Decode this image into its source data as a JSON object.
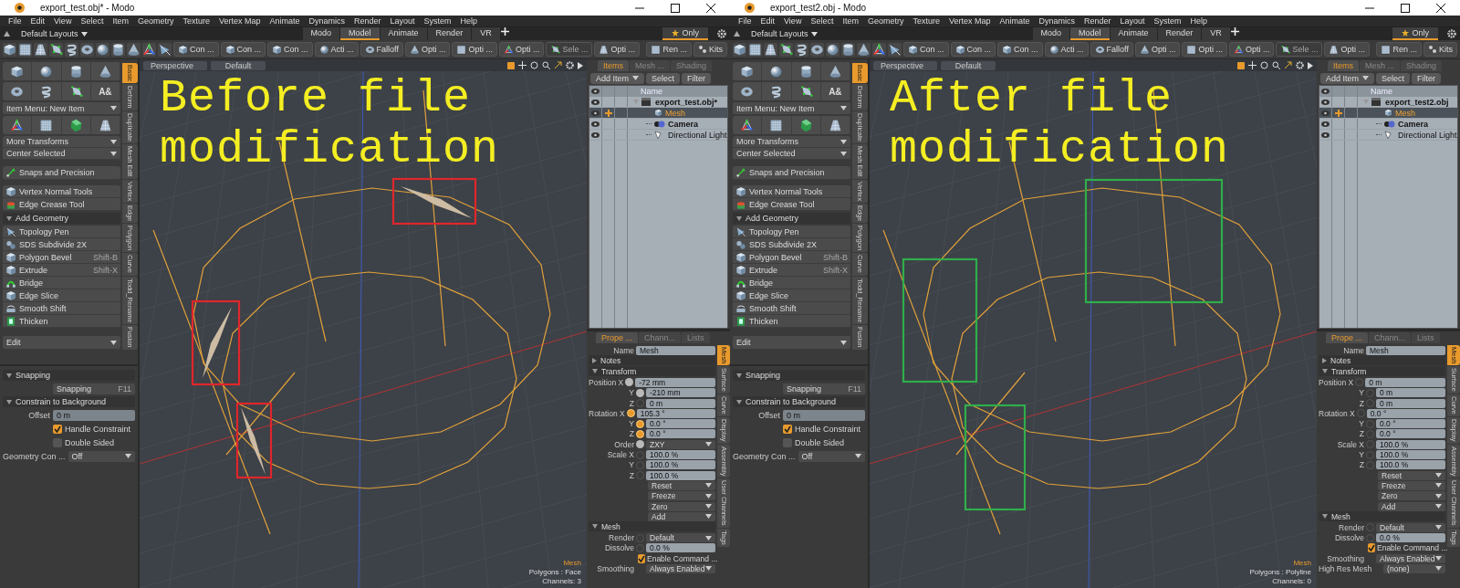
{
  "windows": [
    {
      "title_bar": {
        "title": "export_test.obj* - Modo"
      },
      "menu": [
        "File",
        "Edit",
        "View",
        "Select",
        "Item",
        "Geometry",
        "Texture",
        "Vertex Map",
        "Animate",
        "Dynamics",
        "Render",
        "Layout",
        "System",
        "Help"
      ],
      "layout_bar": {
        "layouts": "Default Layouts",
        "tabs": [
          {
            "label": "Modo",
            "selected": false
          },
          {
            "label": "Model",
            "selected": true
          },
          {
            "label": "Animate",
            "selected": false
          },
          {
            "label": "Render",
            "selected": false
          },
          {
            "label": "VR",
            "selected": false
          }
        ],
        "only": "Only"
      },
      "toolbar": [
        {
          "label": "Con ...",
          "disabled": false
        },
        {
          "label": "Con ...",
          "disabled": false
        },
        {
          "label": "Con ...",
          "disabled": false
        },
        {
          "label": "Acti ...",
          "disabled": false
        },
        {
          "label": "Falloff",
          "disabled": false
        },
        {
          "label": "Opti ...",
          "disabled": false
        },
        {
          "label": "Opti ...",
          "disabled": false
        },
        {
          "label": "Opti ...",
          "disabled": false
        },
        {
          "label": "Sele ...",
          "disabled": true
        },
        {
          "label": "Opti ...",
          "disabled": false
        },
        {
          "label": "Ren ...",
          "disabled": false
        },
        {
          "label": "Kits",
          "disabled": false
        }
      ],
      "toolbox": {
        "text_tool_glyph": "A&",
        "item_menu": "Item Menu: New Item",
        "dropdowns": [
          "More Transforms",
          "Center Selected"
        ],
        "snaps": "Snaps and Precision",
        "tools": [
          "Vertex Normal Tools",
          "Edge Crease Tool"
        ],
        "add_geometry": {
          "title": "Add Geometry",
          "expanded": true,
          "items": [
            {
              "label": "Topology Pen"
            },
            {
              "label": "SDS Subdivide 2X"
            },
            {
              "label": "Polygon Bevel",
              "shortcut": "Shift-B"
            },
            {
              "label": "Extrude",
              "shortcut": "Shift-X"
            },
            {
              "label": "Bridge"
            },
            {
              "label": "Edge Slice"
            },
            {
              "label": "Smooth Shift"
            },
            {
              "label": "Thicken"
            }
          ]
        },
        "edit": "Edit",
        "vertical_tabs": [
          {
            "label": "Basic",
            "selected": true
          },
          {
            "label": "Deform",
            "selected": false
          },
          {
            "label": "Duplicate",
            "selected": false
          },
          {
            "label": "Mesh Edit",
            "selected": false
          },
          {
            "label": "Vertex",
            "selected": false
          },
          {
            "label": "Edge",
            "selected": false
          },
          {
            "label": "Polygon",
            "selected": false
          },
          {
            "label": "Curve",
            "selected": false
          },
          {
            "label": "Todd_Rename",
            "selected": false
          },
          {
            "label": "Fusion",
            "selected": false
          }
        ]
      },
      "snapping": {
        "title": "Snapping",
        "button": "Snapping",
        "shortcut": "F11",
        "constrain": "Constrain to Background",
        "offset_label": "Offset",
        "offset": "0 m",
        "handle_constraint": {
          "label": "Handle Constraint",
          "checked": true
        },
        "double_sided": {
          "label": "Double Sided",
          "checked": false
        },
        "geometry_label": "Geometry Con ...",
        "geometry_value": "Off"
      },
      "viewport": {
        "view": "Perspective",
        "style": "Default",
        "caption": [
          "Before file",
          "modification"
        ],
        "boxes": [
          {
            "color": "#e0262b",
            "kind": "artifact"
          },
          {
            "color": "#e0262b",
            "kind": "artifact"
          },
          {
            "color": "#e0262b",
            "kind": "artifact"
          }
        ],
        "info": [
          "Mesh",
          "Polygons : Face",
          "Channels: 3"
        ]
      },
      "items_panel": {
        "tabs": [
          {
            "label": "Items",
            "selected": true
          },
          {
            "label": "Mesh ...",
            "selected": false
          },
          {
            "label": "Shading",
            "selected": false
          }
        ],
        "buttons": [
          "Add Item",
          "Select",
          "Filter"
        ],
        "column": "Name",
        "tree": [
          {
            "name": "export_test.obj*",
            "kind": "scene",
            "selected": false,
            "expanded": true,
            "children": [
              {
                "name": "Mesh",
                "kind": "mesh",
                "selected": true
              },
              {
                "name": "Camera",
                "kind": "camera",
                "selected": false
              },
              {
                "name": "Directional Light",
                "kind": "light",
                "selected": false
              }
            ]
          }
        ]
      },
      "properties": {
        "tabs": [
          {
            "label": "Prope ...",
            "selected": true
          },
          {
            "label": "Chann...",
            "selected": false
          },
          {
            "label": "Lists",
            "selected": false
          }
        ],
        "side_tabs": [
          {
            "label": "Mesh",
            "selected": true
          },
          {
            "label": "Surface",
            "selected": false
          },
          {
            "label": "Curve",
            "selected": false
          },
          {
            "label": "Display",
            "selected": false
          },
          {
            "label": "Assembly",
            "selected": false
          },
          {
            "label": "User Channels",
            "selected": false
          },
          {
            "label": "Tags",
            "selected": false
          }
        ],
        "rows": [
          {
            "kind": "name",
            "label": "Name",
            "value": "Mesh"
          },
          {
            "kind": "section",
            "label": "Notes",
            "expanded": false
          },
          {
            "kind": "section",
            "label": "Transform",
            "expanded": true
          },
          {
            "kind": "field",
            "label": "Position X",
            "value": "-72 mm",
            "edited": true,
            "keyed": false
          },
          {
            "kind": "field",
            "label": "Y",
            "value": "-210 mm",
            "edited": true,
            "keyed": false
          },
          {
            "kind": "field",
            "label": "Z",
            "value": "0 m",
            "edited": false,
            "keyed": false
          },
          {
            "kind": "field",
            "label": "Rotation X",
            "value": "105.3 °",
            "edited": false,
            "keyed": true
          },
          {
            "kind": "field",
            "label": "Y",
            "value": "0.0 °",
            "edited": false,
            "keyed": true
          },
          {
            "kind": "field",
            "label": "Z",
            "value": "0.0 °",
            "edited": false,
            "keyed": true
          },
          {
            "kind": "dropdown",
            "label": "Order",
            "value": "ZXY",
            "edited": true,
            "keyed": false
          },
          {
            "kind": "field",
            "label": "Scale X",
            "value": "100.0 %",
            "edited": false,
            "keyed": false
          },
          {
            "kind": "field",
            "label": "Y",
            "value": "100.0 %",
            "edited": false,
            "keyed": false
          },
          {
            "kind": "field",
            "label": "Z",
            "value": "100.0 %",
            "edited": false,
            "keyed": false
          },
          {
            "kind": "menu",
            "value": "Reset"
          },
          {
            "kind": "menu",
            "value": "Freeze"
          },
          {
            "kind": "menu",
            "value": "Zero"
          },
          {
            "kind": "menu",
            "value": "Add"
          },
          {
            "kind": "section",
            "label": "Mesh",
            "expanded": true
          },
          {
            "kind": "dropdown",
            "label": "Render",
            "value": "Default",
            "edited": false,
            "keyed": false
          },
          {
            "kind": "field",
            "label": "Dissolve",
            "value": "0.0 %",
            "edited": false,
            "keyed": false
          },
          {
            "kind": "checkbox",
            "label": "Enable Command ...",
            "checked": true
          },
          {
            "kind": "dropdown",
            "label": "Smoothing",
            "value": "Always Enabled"
          }
        ]
      }
    },
    {
      "title_bar": {
        "title": "export_test2.obj - Modo"
      },
      "menu": [
        "File",
        "Edit",
        "View",
        "Select",
        "Item",
        "Geometry",
        "Texture",
        "Vertex Map",
        "Animate",
        "Dynamics",
        "Render",
        "Layout",
        "System",
        "Help"
      ],
      "layout_bar": {
        "layouts": "Default Layouts",
        "tabs": [
          {
            "label": "Modo",
            "selected": false
          },
          {
            "label": "Model",
            "selected": true
          },
          {
            "label": "Animate",
            "selected": false
          },
          {
            "label": "Render",
            "selected": false
          },
          {
            "label": "VR",
            "selected": false
          }
        ],
        "only": "Only"
      },
      "toolbar": [
        {
          "label": "Con ...",
          "disabled": false
        },
        {
          "label": "Con ...",
          "disabled": false
        },
        {
          "label": "Con ...",
          "disabled": false
        },
        {
          "label": "Acti ...",
          "disabled": false
        },
        {
          "label": "Falloff",
          "disabled": false
        },
        {
          "label": "Opti ...",
          "disabled": false
        },
        {
          "label": "Opti ...",
          "disabled": false
        },
        {
          "label": "Opti ...",
          "disabled": false
        },
        {
          "label": "Sele ...",
          "disabled": true
        },
        {
          "label": "Opti ...",
          "disabled": false
        },
        {
          "label": "Ren ...",
          "disabled": false
        },
        {
          "label": "Kits",
          "disabled": false
        }
      ],
      "toolbox": {
        "text_tool_glyph": "A&",
        "item_menu": "Item Menu: New Item",
        "dropdowns": [
          "More Transforms",
          "Center Selected"
        ],
        "snaps": "Snaps and Precision",
        "tools": [
          "Vertex Normal Tools",
          "Edge Crease Tool"
        ],
        "add_geometry": {
          "title": "Add Geometry",
          "expanded": true,
          "items": [
            {
              "label": "Topology Pen"
            },
            {
              "label": "SDS Subdivide 2X"
            },
            {
              "label": "Polygon Bevel",
              "shortcut": "Shift-B"
            },
            {
              "label": "Extrude",
              "shortcut": "Shift-X"
            },
            {
              "label": "Bridge"
            },
            {
              "label": "Edge Slice"
            },
            {
              "label": "Smooth Shift"
            },
            {
              "label": "Thicken"
            }
          ]
        },
        "edit": "Edit",
        "vertical_tabs": [
          {
            "label": "Basic",
            "selected": true
          },
          {
            "label": "Deform",
            "selected": false
          },
          {
            "label": "Duplicate",
            "selected": false
          },
          {
            "label": "Mesh Edit",
            "selected": false
          },
          {
            "label": "Vertex",
            "selected": false
          },
          {
            "label": "Edge",
            "selected": false
          },
          {
            "label": "Polygon",
            "selected": false
          },
          {
            "label": "Curve",
            "selected": false
          },
          {
            "label": "Todd_Rename",
            "selected": false
          },
          {
            "label": "Fusion",
            "selected": false
          }
        ]
      },
      "snapping": {
        "title": "Snapping",
        "button": "Snapping",
        "shortcut": "F11",
        "constrain": "Constrain to Background",
        "offset_label": "Offset",
        "offset": "0 m",
        "handle_constraint": {
          "label": "Handle Constraint",
          "checked": true
        },
        "double_sided": {
          "label": "Double Sided",
          "checked": false
        },
        "geometry_label": "Geometry Con ...",
        "geometry_value": "Off"
      },
      "viewport": {
        "view": "Perspective",
        "style": "Default",
        "caption": [
          "After file",
          "modification"
        ],
        "boxes": [
          {
            "color": "#2fae4a",
            "kind": "clean"
          },
          {
            "color": "#2fae4a",
            "kind": "clean"
          },
          {
            "color": "#2fae4a",
            "kind": "clean"
          }
        ],
        "info": [
          "Mesh",
          "Polygons : Polyline",
          "Channels: 0"
        ]
      },
      "items_panel": {
        "tabs": [
          {
            "label": "Items",
            "selected": true
          },
          {
            "label": "Mesh ...",
            "selected": false
          },
          {
            "label": "Shading",
            "selected": false
          }
        ],
        "buttons": [
          "Add Item",
          "Select",
          "Filter"
        ],
        "column": "Name",
        "tree": [
          {
            "name": "export_test2.obj",
            "kind": "scene",
            "selected": false,
            "expanded": true,
            "children": [
              {
                "name": "Mesh",
                "kind": "mesh",
                "selected": true
              },
              {
                "name": "Camera",
                "kind": "camera",
                "selected": false
              },
              {
                "name": "Directional Light",
                "kind": "light",
                "selected": false
              }
            ]
          }
        ]
      },
      "properties": {
        "tabs": [
          {
            "label": "Prope ...",
            "selected": true
          },
          {
            "label": "Chann...",
            "selected": false
          },
          {
            "label": "Lists",
            "selected": false
          }
        ],
        "side_tabs": [
          {
            "label": "Mesh",
            "selected": true
          },
          {
            "label": "Surface",
            "selected": false
          },
          {
            "label": "Curve",
            "selected": false
          },
          {
            "label": "Display",
            "selected": false
          },
          {
            "label": "Assembly",
            "selected": false
          },
          {
            "label": "User Channels",
            "selected": false
          },
          {
            "label": "Tags",
            "selected": false
          }
        ],
        "rows": [
          {
            "kind": "name",
            "label": "Name",
            "value": "Mesh"
          },
          {
            "kind": "section",
            "label": "Notes",
            "expanded": false
          },
          {
            "kind": "section",
            "label": "Transform",
            "expanded": true
          },
          {
            "kind": "field",
            "label": "Position X",
            "value": "0 m",
            "edited": false,
            "keyed": false
          },
          {
            "kind": "field",
            "label": "Y",
            "value": "0 m",
            "edited": false,
            "keyed": false
          },
          {
            "kind": "field",
            "label": "Z",
            "value": "0 m",
            "edited": false,
            "keyed": false
          },
          {
            "kind": "field",
            "label": "Rotation X",
            "value": "0.0 °",
            "edited": false,
            "keyed": false
          },
          {
            "kind": "field",
            "label": "Y",
            "value": "0.0 °",
            "edited": false,
            "keyed": false
          },
          {
            "kind": "field",
            "label": "Z",
            "value": "0.0 °",
            "edited": false,
            "keyed": false
          },
          {
            "kind": "field",
            "label": "Scale X",
            "value": "100.0 %",
            "edited": false,
            "keyed": false
          },
          {
            "kind": "field",
            "label": "Y",
            "value": "100.0 %",
            "edited": false,
            "keyed": false
          },
          {
            "kind": "field",
            "label": "Z",
            "value": "100.0 %",
            "edited": false,
            "keyed": false
          },
          {
            "kind": "menu",
            "value": "Reset"
          },
          {
            "kind": "menu",
            "value": "Freeze"
          },
          {
            "kind": "menu",
            "value": "Zero"
          },
          {
            "kind": "menu",
            "value": "Add"
          },
          {
            "kind": "section",
            "label": "Mesh",
            "expanded": true
          },
          {
            "kind": "dropdown",
            "label": "Render",
            "value": "Default",
            "edited": false,
            "keyed": false
          },
          {
            "kind": "field",
            "label": "Dissolve",
            "value": "0.0 %",
            "edited": false,
            "keyed": false
          },
          {
            "kind": "checkbox",
            "label": "Enable Command ...",
            "checked": true
          },
          {
            "kind": "dropdown",
            "label": "Smoothing",
            "value": "Always Enabled"
          },
          {
            "kind": "dropdown",
            "label": "High Res Mesh",
            "value": "(none)"
          }
        ]
      }
    }
  ]
}
